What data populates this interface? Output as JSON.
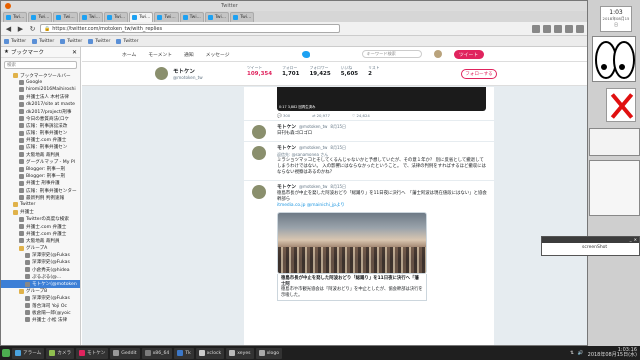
{
  "window": {
    "title_text": "Twitter",
    "tabs": [
      {
        "label": "Twi..."
      },
      {
        "label": "Twi..."
      },
      {
        "label": "Twi..."
      },
      {
        "label": "Twi..."
      },
      {
        "label": "Twi..."
      },
      {
        "label": "Twi..."
      },
      {
        "label": "Twi..."
      },
      {
        "label": "Twi..."
      },
      {
        "label": "Twi..."
      },
      {
        "label": "Twi..."
      }
    ]
  },
  "toolbar": {
    "url": "https://twitter.com/motoken_tw/with_replies",
    "back": "◀",
    "forward": "▶",
    "reload": "↻"
  },
  "bookmarks_bar": [
    {
      "label": "Twitter"
    },
    {
      "label": "Twitter"
    },
    {
      "label": "Twitter"
    },
    {
      "label": "Twitter"
    },
    {
      "label": "Twitter"
    }
  ],
  "sidebar": {
    "title": "ブックマーク",
    "search_placeholder": "検索",
    "items": [
      {
        "label": "ブックマークツールバー",
        "level": "lvl1",
        "kind": "folder"
      },
      {
        "label": "Google",
        "level": "lvl2",
        "kind": "page"
      },
      {
        "label": "hiromi2016Maihiroshi",
        "level": "lvl2",
        "kind": "page"
      },
      {
        "label": "弁護士法人 木村法律",
        "level": "lvl2",
        "kind": "page"
      },
      {
        "label": "dk2017/site at maste",
        "level": "lvl2",
        "kind": "page"
      },
      {
        "label": "dk2017/project/刑事",
        "level": "lvl2",
        "kind": "page"
      },
      {
        "label": "今日の悪質商法(ロケ",
        "level": "lvl2",
        "kind": "page"
      },
      {
        "label": "広報：刑事訴訟法改",
        "level": "lvl2",
        "kind": "page"
      },
      {
        "label": "広報：刑事弁護セン",
        "level": "lvl2",
        "kind": "page"
      },
      {
        "label": "弁護士.com 弁護士",
        "level": "lvl2",
        "kind": "page"
      },
      {
        "label": "広報：刑事弁護セン",
        "level": "lvl2",
        "kind": "page"
      },
      {
        "label": "大阪地裁 裁判員",
        "level": "lvl2",
        "kind": "page"
      },
      {
        "label": "グーグルマップ - My Pl",
        "level": "lvl2",
        "kind": "page"
      },
      {
        "label": "Blogger: 刑事ー刑",
        "level": "lvl2",
        "kind": "page"
      },
      {
        "label": "Blogger: 刑事ー刑",
        "level": "lvl2",
        "kind": "page"
      },
      {
        "label": "弁護士 刑事弁護",
        "level": "lvl2",
        "kind": "page"
      },
      {
        "label": "広報：刑事弁護センター",
        "level": "lvl2",
        "kind": "page"
      },
      {
        "label": "最新判例 判例速報",
        "level": "lvl2",
        "kind": "page"
      },
      {
        "label": "Twitter",
        "level": "lvl1",
        "kind": "folder"
      },
      {
        "label": "弁護士",
        "level": "lvl1",
        "kind": "folder"
      },
      {
        "label": "Twitterの高度な検索",
        "level": "lvl2",
        "kind": "page"
      },
      {
        "label": "弁護士.com 弁護士",
        "level": "lvl2",
        "kind": "page"
      },
      {
        "label": "弁護士.com 弁護士",
        "level": "lvl2",
        "kind": "page"
      },
      {
        "label": "大阪地裁 裁判員",
        "level": "lvl2",
        "kind": "page"
      },
      {
        "label": "グループA",
        "level": "lvl2",
        "kind": "folder"
      },
      {
        "label": "深澤崇史(@Fukas",
        "level": "lvl3",
        "kind": "page"
      },
      {
        "label": "深澤崇史(@Fukas",
        "level": "lvl3",
        "kind": "page"
      },
      {
        "label": "小倉秀夫(@hidea",
        "level": "lvl3",
        "kind": "page"
      },
      {
        "label": "ぷるぷる(@...",
        "level": "lvl3",
        "kind": "page"
      },
      {
        "label": "モトケン(@motoken",
        "level": "lvl3",
        "kind": "page",
        "selected": true
      },
      {
        "label": "グループB",
        "level": "lvl2",
        "kind": "folder"
      },
      {
        "label": "深澤崇史(@Fukas",
        "level": "lvl3",
        "kind": "page"
      },
      {
        "label": "落合洋司 Yoji Oc",
        "level": "lvl3",
        "kind": "page"
      },
      {
        "label": "板倉陽一郎(@yoic",
        "level": "lvl3",
        "kind": "page"
      },
      {
        "label": "弁護士 小松 法律",
        "level": "lvl3",
        "kind": "page"
      }
    ]
  },
  "twitter": {
    "nav": {
      "home": "ホーム",
      "moments": "モーメント",
      "notifications": "通知",
      "messages": "メッセージ",
      "search_placeholder": "キーワード検索",
      "tweet_button": "ツイート"
    },
    "profile": {
      "name": "モトケン",
      "handle": "@motoken_tw",
      "follow_button": "フォローする",
      "stats": [
        {
          "label": "ツイート",
          "value": "109,354",
          "accent": true
        },
        {
          "label": "フォロー",
          "value": "1,701",
          "accent": false
        },
        {
          "label": "フォロワー",
          "value": "19,425",
          "accent": false
        },
        {
          "label": "いいね",
          "value": "5,605",
          "accent": false
        },
        {
          "label": "リスト",
          "value": "2",
          "accent": false
        }
      ]
    },
    "top_media": {
      "caption": "0:17  3,882 回再生済み"
    },
    "top_actions": {
      "replies": "300",
      "retweets": "20,977",
      "likes": "24,624"
    },
    "tweets": [
      {
        "name": "モトケン",
        "handle": "@motoken_tw",
        "time": "8月15日",
        "reply_to": "",
        "text": "日刊も森ゴロゴロ",
        "link": "",
        "has_image": false
      },
      {
        "name": "モトケン",
        "handle": "@motoken_tw",
        "time": "8月15日",
        "reply_to": "返信先: @sanamonea さん",
        "text": "ミラショツマッコとそしてくるんじゃないかと予想していたが、その意１年か？ 別に反省として撤退してしまうわけではない。 入の影響にはならなかったということ。 で、法律の判例をすればするほど撤収にはならない視察はあるのかね？",
        "link": "",
        "has_image": false
      },
      {
        "name": "モトケン",
        "handle": "@motoken_tw",
        "time": "8月15日",
        "reply_to": "",
        "text": "徳島市長が中止を発した阿波おどり「総踊り」を11日夜に決行へ　「藩士阿波は現在値段にはない」と協会幹部ら",
        "link": "itmedia.co.jp",
        "link2": "@mainichi_jpより",
        "has_image": true,
        "card_title": "徳島市長が中止を発した阿波おどり「総踊り」を11日夜に決行へ「藩士阿",
        "card_body": "徳島市や市観光協会は「阿波おどり」を中止としたが、協会幹部は決行を示唆した。"
      }
    ]
  },
  "desktop": {
    "clock_time": "1:03",
    "clock_date": "2018年08月15日",
    "screenshot_label": "screenShot"
  },
  "taskbar": {
    "items": [
      {
        "label": "アラーム",
        "color": "#4aa3df"
      },
      {
        "label": "カメラ",
        "color": "#8fbf4f"
      },
      {
        "label": "モトケン",
        "color": "#e0245e"
      },
      {
        "label": "Geddit",
        "color": "#999999"
      },
      {
        "label": "x86_64",
        "color": "#7c7c7c"
      },
      {
        "label": "Tk",
        "color": "#3c78c8"
      },
      {
        "label": "xclock",
        "color": "#cccccc"
      },
      {
        "label": "xeyes",
        "color": "#bbbbbb"
      },
      {
        "label": "xlogo",
        "color": "#aaaaaa"
      }
    ],
    "tray_time": "1:03:16",
    "tray_date": "2018年08月15日(水)"
  }
}
